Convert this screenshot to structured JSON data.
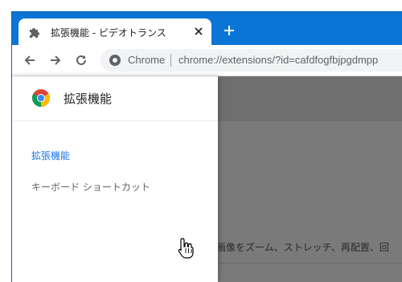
{
  "tab": {
    "title": "拡張機能 - ビデオトランス",
    "icon": "puzzle-piece-icon",
    "close_icon": "close-icon"
  },
  "new_tab": {
    "icon": "plus-icon"
  },
  "toolbar": {
    "back_icon": "back-arrow-icon",
    "forward_icon": "forward-arrow-icon",
    "reload_icon": "reload-icon",
    "site_label": "Chrome",
    "url": "chrome://extensions/?id=cafdfogfbjpgdmpp"
  },
  "drawer": {
    "title": "拡張機能",
    "items": [
      {
        "label": "拡張機能",
        "active": true
      },
      {
        "label": "キーボード ショートカット",
        "active": false
      }
    ]
  },
  "background": {
    "text": "画像をズーム、ストレッチ、再配置、回"
  },
  "colors": {
    "frame": "#0b75d6",
    "accent": "#1a73e8",
    "scrim": "#7a7a7a"
  }
}
